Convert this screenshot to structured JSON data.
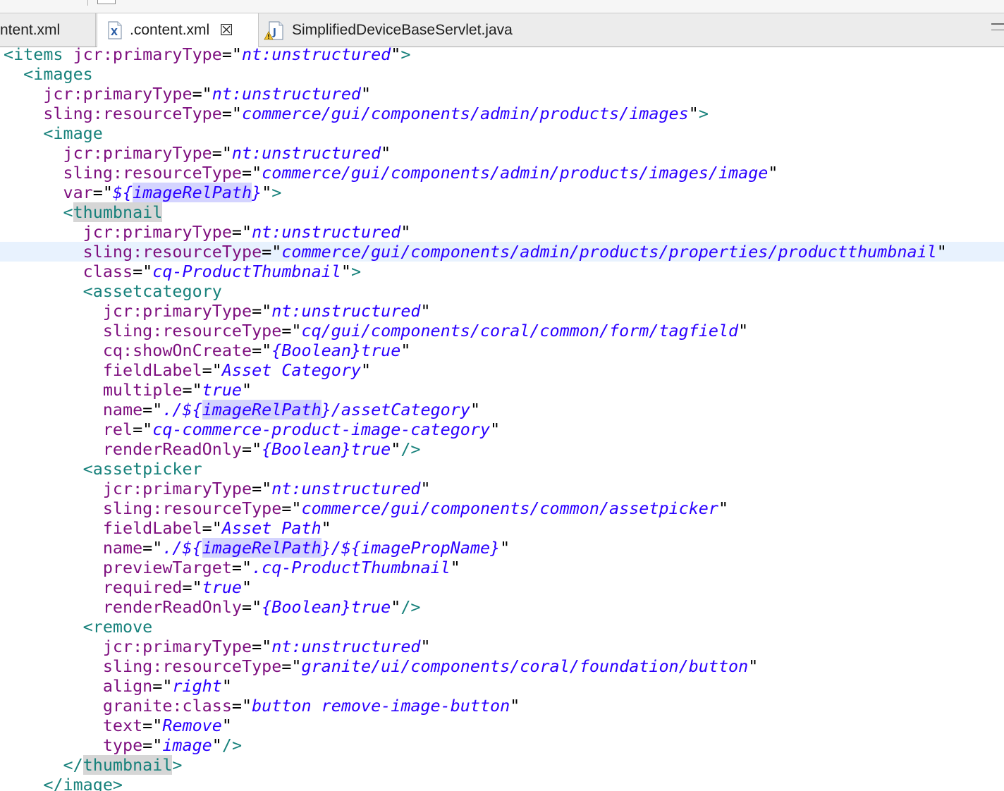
{
  "tabs": [
    {
      "label": "ntent.xml",
      "icon": "none",
      "active": false
    },
    {
      "label": ".content.xml",
      "icon": "xml-file-icon",
      "active": true,
      "close": "☒"
    },
    {
      "label": "SimplifiedDeviceBaseServlet.java",
      "icon": "java-file-warning-icon",
      "active": false
    }
  ],
  "colors": {
    "tag": "#17817b",
    "attribute": "#7e0f7f",
    "value": "#2a00ff",
    "current_line": "#e8f2fe",
    "occurrence_highlight": "#d4d4ff",
    "tag_match": "#d6d6d6"
  },
  "current_line_index": 10,
  "editor_lines": [
    {
      "indent": 0,
      "tokens": [
        {
          "k": "t",
          "s": "<items"
        },
        {
          "k": "p",
          "s": " "
        },
        {
          "k": "a",
          "s": "jcr:primaryType"
        },
        {
          "k": "q",
          "s": "=\""
        },
        {
          "k": "v",
          "s": "nt:unstructured"
        },
        {
          "k": "q",
          "s": "\""
        },
        {
          "k": "t",
          "s": ">"
        }
      ]
    },
    {
      "indent": 2,
      "tokens": [
        {
          "k": "t",
          "s": "<images"
        }
      ]
    },
    {
      "indent": 4,
      "tokens": [
        {
          "k": "a",
          "s": "jcr:primaryType"
        },
        {
          "k": "q",
          "s": "=\""
        },
        {
          "k": "v",
          "s": "nt:unstructured"
        },
        {
          "k": "q",
          "s": "\""
        }
      ]
    },
    {
      "indent": 4,
      "tokens": [
        {
          "k": "a",
          "s": "sling:resourceType"
        },
        {
          "k": "q",
          "s": "=\""
        },
        {
          "k": "v",
          "s": "commerce/gui/components/admin/products/images"
        },
        {
          "k": "q",
          "s": "\""
        },
        {
          "k": "t",
          "s": ">"
        }
      ]
    },
    {
      "indent": 4,
      "tokens": [
        {
          "k": "t",
          "s": "<image"
        }
      ]
    },
    {
      "indent": 6,
      "tokens": [
        {
          "k": "a",
          "s": "jcr:primaryType"
        },
        {
          "k": "q",
          "s": "=\""
        },
        {
          "k": "v",
          "s": "nt:unstructured"
        },
        {
          "k": "q",
          "s": "\""
        }
      ]
    },
    {
      "indent": 6,
      "tokens": [
        {
          "k": "a",
          "s": "sling:resourceType"
        },
        {
          "k": "q",
          "s": "=\""
        },
        {
          "k": "v",
          "s": "commerce/gui/components/admin/products/images/image"
        },
        {
          "k": "q",
          "s": "\""
        }
      ]
    },
    {
      "indent": 6,
      "tokens": [
        {
          "k": "a",
          "s": "var"
        },
        {
          "k": "q",
          "s": "=\""
        },
        {
          "k": "v",
          "s": "${"
        },
        {
          "k": "vh",
          "s": "imageRelPath"
        },
        {
          "k": "v",
          "s": "}"
        },
        {
          "k": "q",
          "s": "\""
        },
        {
          "k": "t",
          "s": ">"
        }
      ]
    },
    {
      "indent": 6,
      "tokens": [
        {
          "k": "t",
          "s": "<"
        },
        {
          "k": "tm",
          "s": "thumbnail"
        }
      ]
    },
    {
      "indent": 8,
      "tokens": [
        {
          "k": "a",
          "s": "jcr:primaryType"
        },
        {
          "k": "q",
          "s": "=\""
        },
        {
          "k": "v",
          "s": "nt:unstructured"
        },
        {
          "k": "q",
          "s": "\""
        }
      ]
    },
    {
      "indent": 8,
      "tokens": [
        {
          "k": "a",
          "s": "sling:resourceType"
        },
        {
          "k": "q",
          "s": "=\""
        },
        {
          "k": "v",
          "s": "commerce/gui/components/admin/products/properties/productthumbnail"
        },
        {
          "k": "q",
          "s": "\""
        }
      ]
    },
    {
      "indent": 8,
      "tokens": [
        {
          "k": "a",
          "s": "class"
        },
        {
          "k": "q",
          "s": "=\""
        },
        {
          "k": "v",
          "s": "cq-ProductThumbnail"
        },
        {
          "k": "q",
          "s": "\""
        },
        {
          "k": "t",
          "s": ">"
        }
      ]
    },
    {
      "indent": 8,
      "tokens": [
        {
          "k": "t",
          "s": "<assetcategory"
        }
      ]
    },
    {
      "indent": 10,
      "tokens": [
        {
          "k": "a",
          "s": "jcr:primaryType"
        },
        {
          "k": "q",
          "s": "=\""
        },
        {
          "k": "v",
          "s": "nt:unstructured"
        },
        {
          "k": "q",
          "s": "\""
        }
      ]
    },
    {
      "indent": 10,
      "tokens": [
        {
          "k": "a",
          "s": "sling:resourceType"
        },
        {
          "k": "q",
          "s": "=\""
        },
        {
          "k": "v",
          "s": "cq/gui/components/coral/common/form/tagfield"
        },
        {
          "k": "q",
          "s": "\""
        }
      ]
    },
    {
      "indent": 10,
      "tokens": [
        {
          "k": "a",
          "s": "cq:showOnCreate"
        },
        {
          "k": "q",
          "s": "=\""
        },
        {
          "k": "v",
          "s": "{Boolean}true"
        },
        {
          "k": "q",
          "s": "\""
        }
      ]
    },
    {
      "indent": 10,
      "tokens": [
        {
          "k": "a",
          "s": "fieldLabel"
        },
        {
          "k": "q",
          "s": "=\""
        },
        {
          "k": "v",
          "s": "Asset Category"
        },
        {
          "k": "q",
          "s": "\""
        }
      ]
    },
    {
      "indent": 10,
      "tokens": [
        {
          "k": "a",
          "s": "multiple"
        },
        {
          "k": "q",
          "s": "=\""
        },
        {
          "k": "v",
          "s": "true"
        },
        {
          "k": "q",
          "s": "\""
        }
      ]
    },
    {
      "indent": 10,
      "tokens": [
        {
          "k": "a",
          "s": "name"
        },
        {
          "k": "q",
          "s": "=\""
        },
        {
          "k": "v",
          "s": "./${"
        },
        {
          "k": "vh",
          "s": "imageRelPath"
        },
        {
          "k": "v",
          "s": "}/assetCategory"
        },
        {
          "k": "q",
          "s": "\""
        }
      ]
    },
    {
      "indent": 10,
      "tokens": [
        {
          "k": "a",
          "s": "rel"
        },
        {
          "k": "q",
          "s": "=\""
        },
        {
          "k": "v",
          "s": "cq-commerce-product-image-category"
        },
        {
          "k": "q",
          "s": "\""
        }
      ]
    },
    {
      "indent": 10,
      "tokens": [
        {
          "k": "a",
          "s": "renderReadOnly"
        },
        {
          "k": "q",
          "s": "=\""
        },
        {
          "k": "v",
          "s": "{Boolean}true"
        },
        {
          "k": "q",
          "s": "\""
        },
        {
          "k": "t",
          "s": "/>"
        }
      ]
    },
    {
      "indent": 8,
      "tokens": [
        {
          "k": "t",
          "s": "<assetpicker"
        }
      ]
    },
    {
      "indent": 10,
      "tokens": [
        {
          "k": "a",
          "s": "jcr:primaryType"
        },
        {
          "k": "q",
          "s": "=\""
        },
        {
          "k": "v",
          "s": "nt:unstructured"
        },
        {
          "k": "q",
          "s": "\""
        }
      ]
    },
    {
      "indent": 10,
      "tokens": [
        {
          "k": "a",
          "s": "sling:resourceType"
        },
        {
          "k": "q",
          "s": "=\""
        },
        {
          "k": "v",
          "s": "commerce/gui/components/common/assetpicker"
        },
        {
          "k": "q",
          "s": "\""
        }
      ]
    },
    {
      "indent": 10,
      "tokens": [
        {
          "k": "a",
          "s": "fieldLabel"
        },
        {
          "k": "q",
          "s": "=\""
        },
        {
          "k": "v",
          "s": "Asset Path"
        },
        {
          "k": "q",
          "s": "\""
        }
      ]
    },
    {
      "indent": 10,
      "tokens": [
        {
          "k": "a",
          "s": "name"
        },
        {
          "k": "q",
          "s": "=\""
        },
        {
          "k": "v",
          "s": "./${"
        },
        {
          "k": "vh",
          "s": "imageRelPath"
        },
        {
          "k": "v",
          "s": "}/${imagePropName}"
        },
        {
          "k": "q",
          "s": "\""
        }
      ]
    },
    {
      "indent": 10,
      "tokens": [
        {
          "k": "a",
          "s": "previewTarget"
        },
        {
          "k": "q",
          "s": "=\""
        },
        {
          "k": "v",
          "s": ".cq-ProductThumbnail"
        },
        {
          "k": "q",
          "s": "\""
        }
      ]
    },
    {
      "indent": 10,
      "tokens": [
        {
          "k": "a",
          "s": "required"
        },
        {
          "k": "q",
          "s": "=\""
        },
        {
          "k": "v",
          "s": "true"
        },
        {
          "k": "q",
          "s": "\""
        }
      ]
    },
    {
      "indent": 10,
      "tokens": [
        {
          "k": "a",
          "s": "renderReadOnly"
        },
        {
          "k": "q",
          "s": "=\""
        },
        {
          "k": "v",
          "s": "{Boolean}true"
        },
        {
          "k": "q",
          "s": "\""
        },
        {
          "k": "t",
          "s": "/>"
        }
      ]
    },
    {
      "indent": 8,
      "tokens": [
        {
          "k": "t",
          "s": "<remove"
        }
      ]
    },
    {
      "indent": 10,
      "tokens": [
        {
          "k": "a",
          "s": "jcr:primaryType"
        },
        {
          "k": "q",
          "s": "=\""
        },
        {
          "k": "v",
          "s": "nt:unstructured"
        },
        {
          "k": "q",
          "s": "\""
        }
      ]
    },
    {
      "indent": 10,
      "tokens": [
        {
          "k": "a",
          "s": "sling:resourceType"
        },
        {
          "k": "q",
          "s": "=\""
        },
        {
          "k": "v",
          "s": "granite/ui/components/coral/foundation/button"
        },
        {
          "k": "q",
          "s": "\""
        }
      ]
    },
    {
      "indent": 10,
      "tokens": [
        {
          "k": "a",
          "s": "align"
        },
        {
          "k": "q",
          "s": "=\""
        },
        {
          "k": "v",
          "s": "right"
        },
        {
          "k": "q",
          "s": "\""
        }
      ]
    },
    {
      "indent": 10,
      "tokens": [
        {
          "k": "a",
          "s": "granite:class"
        },
        {
          "k": "q",
          "s": "=\""
        },
        {
          "k": "v",
          "s": "button remove-image-button"
        },
        {
          "k": "q",
          "s": "\""
        }
      ]
    },
    {
      "indent": 10,
      "tokens": [
        {
          "k": "a",
          "s": "text"
        },
        {
          "k": "q",
          "s": "=\""
        },
        {
          "k": "v",
          "s": "Remove"
        },
        {
          "k": "q",
          "s": "\""
        }
      ]
    },
    {
      "indent": 10,
      "tokens": [
        {
          "k": "a",
          "s": "type"
        },
        {
          "k": "q",
          "s": "=\""
        },
        {
          "k": "v",
          "s": "image"
        },
        {
          "k": "q",
          "s": "\""
        },
        {
          "k": "t",
          "s": "/>"
        }
      ]
    },
    {
      "indent": 6,
      "tokens": [
        {
          "k": "t",
          "s": "</"
        },
        {
          "k": "tm",
          "s": "thumbnail"
        },
        {
          "k": "t",
          "s": ">"
        }
      ]
    },
    {
      "indent": 4,
      "tokens": [
        {
          "k": "t",
          "s": "</image>"
        }
      ]
    }
  ]
}
